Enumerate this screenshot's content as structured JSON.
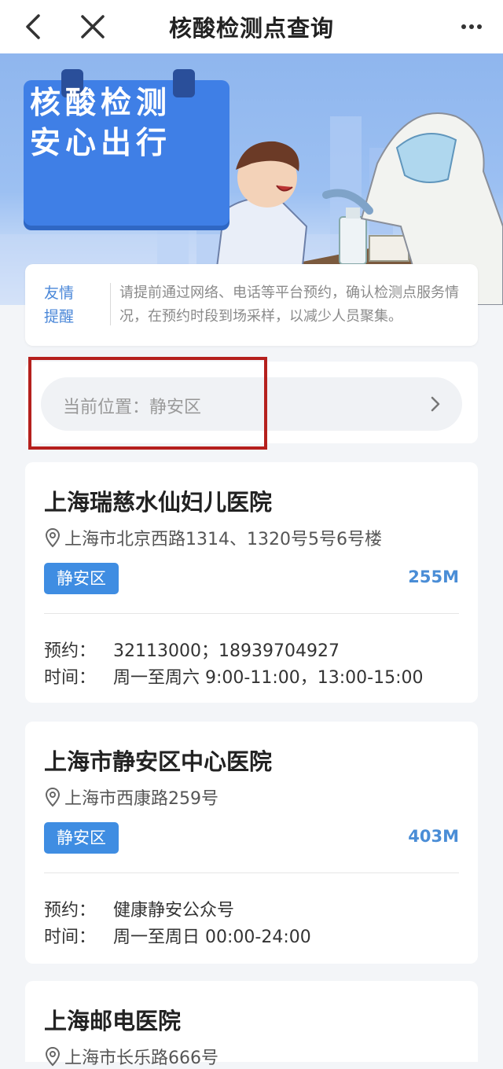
{
  "nav": {
    "title": "核酸检测点查询"
  },
  "banner": {
    "line1": "核酸检测",
    "line2": "安心出行"
  },
  "notice": {
    "tag_line1": "友情",
    "tag_line2": "提醒",
    "text": "请提前通过网络、电话等平台预约，确认检测点服务情况，在预约时段到场采样，以减少人员聚集。"
  },
  "location": {
    "label": "当前位置：静安区"
  },
  "hospitals": [
    {
      "name": "上海瑞慈水仙妇儿医院",
      "address": "上海市北京西路1314、1320号5号6号楼",
      "district": "静安区",
      "distance": "255M",
      "booking_key": "预约：",
      "booking": "32113000；18939704927",
      "hours_key": "时间：",
      "hours": "周一至周六 9:00-11:00，13:00-15:00"
    },
    {
      "name": "上海市静安区中心医院",
      "address": "上海市西康路259号",
      "district": "静安区",
      "distance": "403M",
      "booking_key": "预约：",
      "booking": "健康静安公众号",
      "hours_key": "时间：",
      "hours": "周一至周日 00:00-24:00"
    },
    {
      "name": "上海邮电医院",
      "address": "上海市长乐路666号"
    }
  ],
  "colors": {
    "accent": "#3f8de2",
    "highlight_box": "#b5201d"
  }
}
